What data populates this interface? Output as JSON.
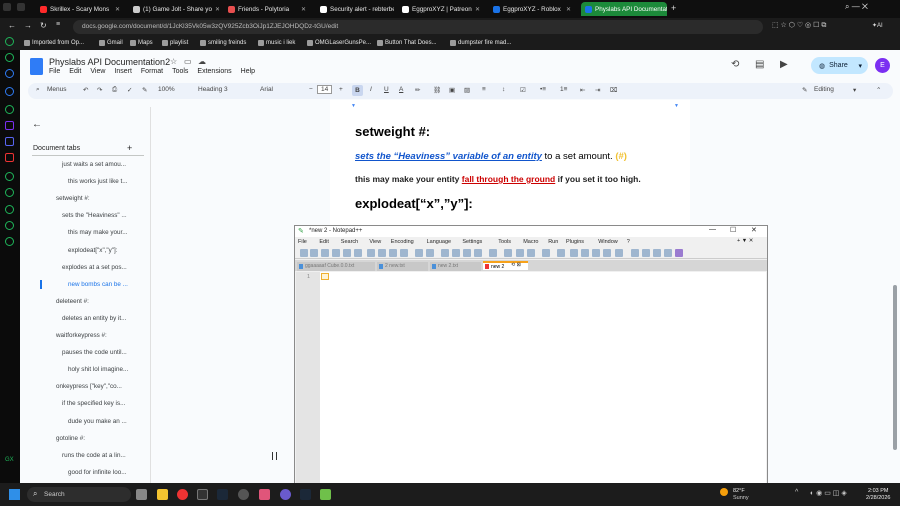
{
  "browser": {
    "tabs": [
      {
        "label": "Skrillex - Scary Mons",
        "color": "#ff2a2a",
        "active": false
      },
      {
        "label": "(1) Game Jolt - Share yo",
        "color": "#cccccc",
        "active": false
      },
      {
        "label": "Friends - Polytoria",
        "color": "#e84f4f",
        "active": false
      },
      {
        "label": "Security alert - rebterbe",
        "color": "#ffffff",
        "active": false
      },
      {
        "label": "EggproXYZ | Patreon",
        "color": "#ffffff",
        "active": false
      },
      {
        "label": "EggproXYZ - Roblox",
        "color": "#1a73e8",
        "active": false
      },
      {
        "label": "Physlabs API Documentat",
        "color": "#1a73e8",
        "active": true
      }
    ],
    "new_tab": "+",
    "url": "docs.google.com/document/d/1JcKl35Vk05w3zQV925Zcb3OiJp1ZJEJOHDQDz-tGU/edit",
    "bookmarks": [
      "Imported from Op...",
      "Gmail",
      "Maps",
      "playlist",
      "smiling freinds",
      "music i liek",
      "OMGLaserGunsPe...",
      "Button That Does...",
      "dumpster fire mad..."
    ]
  },
  "docs": {
    "title": "Physlabs API Documentation2",
    "menu": [
      "File",
      "Edit",
      "View",
      "Insert",
      "Format",
      "Tools",
      "Extensions",
      "Help"
    ],
    "share_label": "Share",
    "avatar_letter": "E",
    "toolbar": {
      "menus": "Menus",
      "zoom": "100%",
      "style": "Heading 3",
      "font": "Arial",
      "font_size": "14",
      "mode": "Editing"
    },
    "outline": {
      "title": "Document tabs",
      "items": [
        {
          "text": "just waits a set amou...",
          "level": 2
        },
        {
          "text": "this works just like t...",
          "level": 3
        },
        {
          "text": "setweight #:",
          "level": 1
        },
        {
          "text": "sets the \"Heaviness\" ...",
          "level": 2
        },
        {
          "text": "this may make your...",
          "level": 3
        },
        {
          "text": "explodeat[\"x\",\"y\"]:",
          "level": 3
        },
        {
          "text": "explodes at a set pos...",
          "level": 2
        },
        {
          "text": "new bombs can be ...",
          "level": 3,
          "active": true
        },
        {
          "text": "deleteent #:",
          "level": 1
        },
        {
          "text": "deletes an entity by it...",
          "level": 2
        },
        {
          "text": "waitforkeypress #:",
          "level": 1
        },
        {
          "text": "pauses the code until...",
          "level": 2
        },
        {
          "text": "holy shit lol imagine...",
          "level": 3
        },
        {
          "text": "onkeypress [\"key\",\"co...",
          "level": 1
        },
        {
          "text": "if the specified key is...",
          "level": 2
        },
        {
          "text": "dude you make an ...",
          "level": 3
        },
        {
          "text": "gotoline #:",
          "level": 1
        },
        {
          "text": "runs the code at a lin...",
          "level": 2
        },
        {
          "text": "good for infinite loo...",
          "level": 3
        }
      ]
    },
    "page": {
      "h1": "setweight #:",
      "line1_link": "sets the “Heaviness” variable of an entity",
      "line1_rest": " to a set amount. ",
      "line1_tag": "(#)",
      "line2_a": "this may make your entity ",
      "line2_red": "fall through the ground",
      "line2_b": " if you set it too high.",
      "h2": "explodeat[“x”,”y”]:"
    }
  },
  "notepad": {
    "title": "*new 2 - Notepad++",
    "menu": [
      "File",
      "Edit",
      "Search",
      "View",
      "Encoding",
      "Language",
      "Settings",
      "Tools",
      "Macro",
      "Run",
      "Plugins",
      "Window",
      "?"
    ],
    "tabs": [
      "ggaaaaaf Cube.0.0.txt",
      "2 new.txt",
      "new 2.txt",
      "new 2"
    ],
    "line_number": "1"
  },
  "taskbar": {
    "search": "Search",
    "weather_temp": "82°F",
    "weather_cond": "Sunny",
    "time": "2:03 PM",
    "date": "2/28/2026"
  }
}
